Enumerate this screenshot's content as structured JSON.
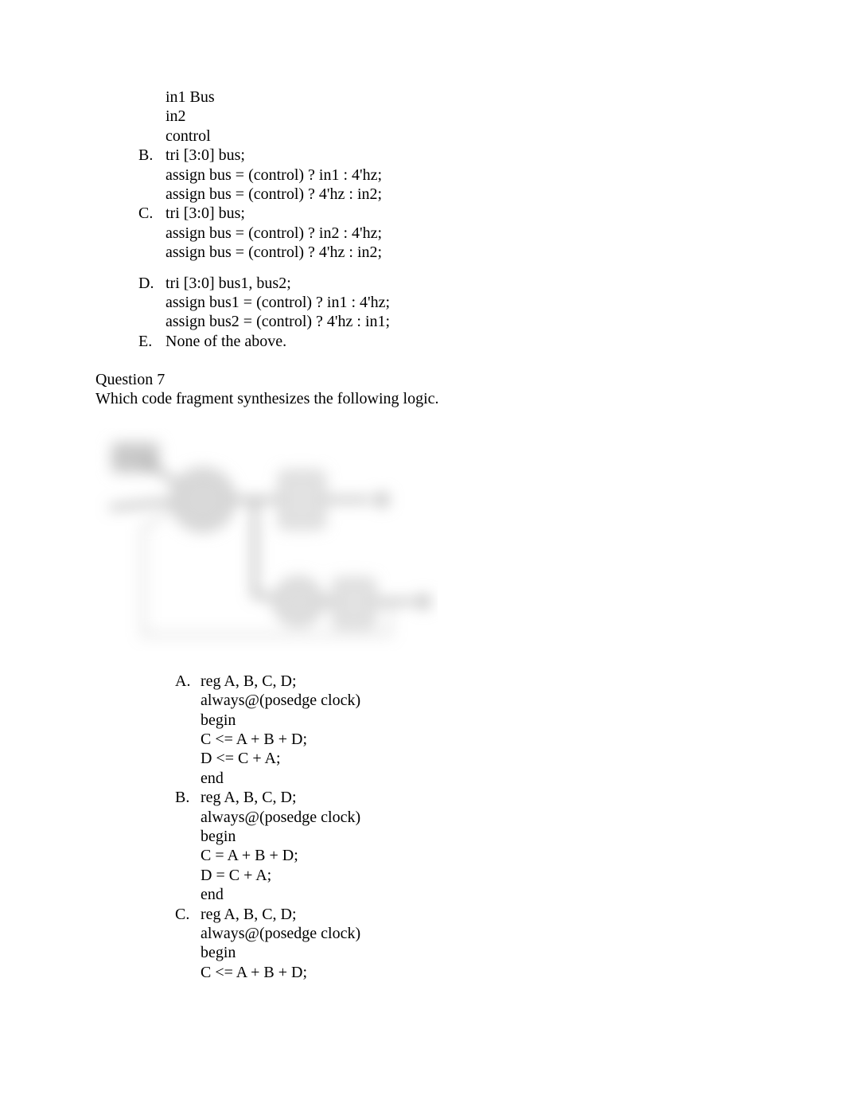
{
  "optionA_lines": {
    "l1": "in1 Bus",
    "l2": "in2",
    "l3": "control"
  },
  "optionB": {
    "marker": "B.",
    "l1": "tri [3:0] bus;",
    "l2": "assign bus = (control) ? in1 : 4'hz;",
    "l3": "assign bus = (control) ? 4'hz : in2;"
  },
  "optionC": {
    "marker": "C.",
    "l1": "tri [3:0] bus;",
    "l2": "assign bus = (control) ? in2 : 4'hz;",
    "l3": "assign bus = (control) ? 4'hz : in2;"
  },
  "optionD": {
    "marker": "D.",
    "l1": "tri [3:0] bus1, bus2;",
    "l2": "assign bus1 = (control) ? in1 : 4'hz;",
    "l3": "assign bus2 = (control) ? 4'hz : in1;"
  },
  "optionE": {
    "marker": "E.",
    "l1": "None of the above."
  },
  "q7": {
    "label": "Question 7",
    "prompt": "Which code fragment synthesizes the following logic."
  },
  "ans": {
    "A": {
      "marker": "A.",
      "l1": "reg A, B, C, D;",
      "l2": "always@(posedge clock)",
      "l3": "begin",
      "l4": "C <= A + B + D;",
      "l5": "D <= C + A;",
      "l6": "end"
    },
    "B": {
      "marker": "B.",
      "l1": "reg A, B, C, D;",
      "l2": "always@(posedge clock)",
      "l3": "begin",
      "l4": "C = A + B + D;",
      "l5": "D = C + A;",
      "l6": "end"
    },
    "C": {
      "marker": "C.",
      "l1": "reg A, B, C, D;",
      "l2": "always@(posedge clock)",
      "l3": "begin",
      "l4": "C <= A + B + D;"
    }
  }
}
